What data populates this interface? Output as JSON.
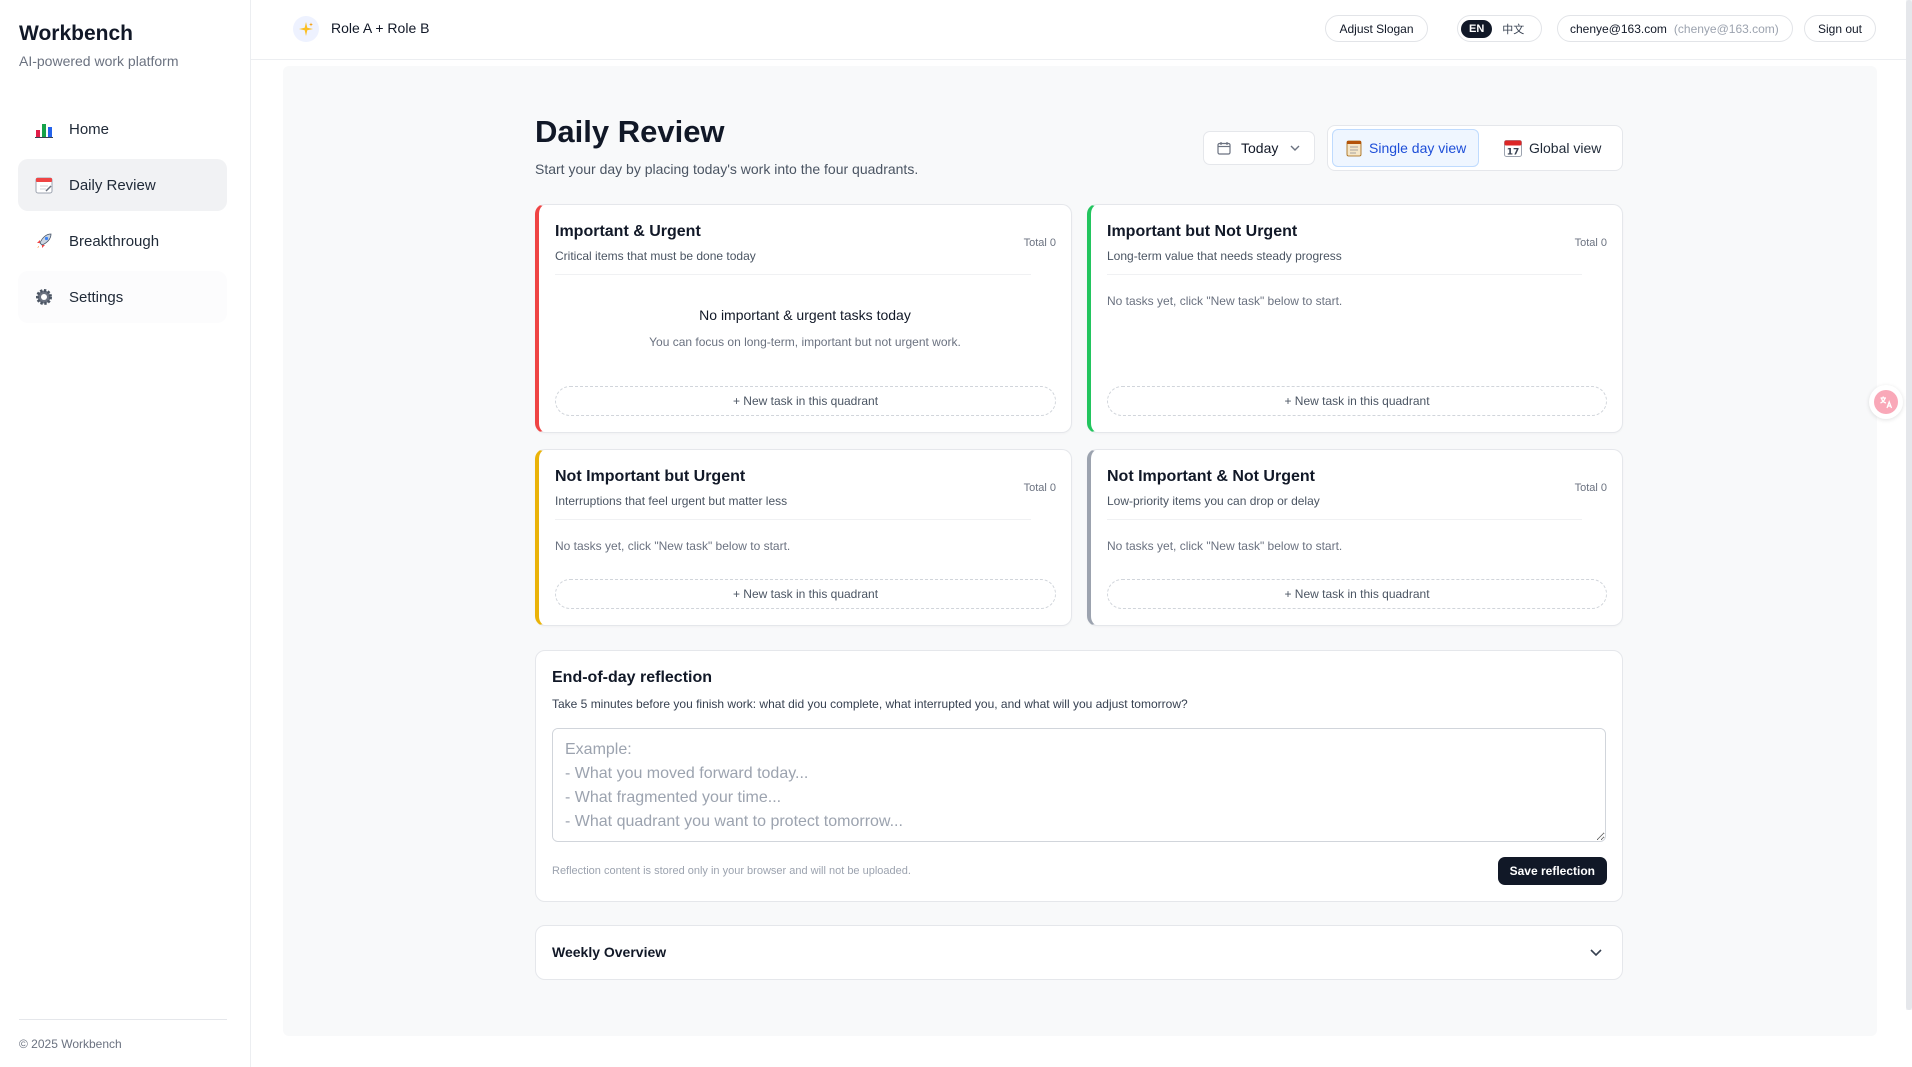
{
  "app": {
    "title": "Workbench",
    "subtitle": "AI-powered work platform",
    "footer": "© 2025 Workbench"
  },
  "nav": {
    "items": [
      {
        "label": "Home",
        "icon": "bar-chart-icon"
      },
      {
        "label": "Daily Review",
        "icon": "calendar-icon",
        "active": true
      },
      {
        "label": "Breakthrough",
        "icon": "rocket-icon"
      },
      {
        "label": "Settings",
        "icon": "gear-icon"
      }
    ]
  },
  "topbar": {
    "slogan": "Role A + Role B",
    "adjust_slogan": "Adjust Slogan",
    "lang_en": "EN",
    "lang_zh": "中文",
    "user_email": "chenye@163.com",
    "user_email_sub": "(chenye@163.com)",
    "sign_out": "Sign out"
  },
  "page": {
    "title": "Daily Review",
    "subtitle": "Start your day by placing today's work into the four quadrants.",
    "date_select": "Today",
    "view_single": "Single day view",
    "view_global": "Global view"
  },
  "quadrants": [
    {
      "title": "Important & Urgent",
      "subtitle": "Critical items that must be done today",
      "total": "Total 0",
      "empty_title": "No important & urgent tasks today",
      "empty_sub": "You can focus on long-term, important but not urgent work.",
      "add": "+ New task in this quadrant",
      "color": "#ef4444"
    },
    {
      "title": "Important but Not Urgent",
      "subtitle": "Long-term value that needs steady progress",
      "total": "Total 0",
      "empty": "No tasks yet, click \"New task\" below to start.",
      "add": "+ New task in this quadrant",
      "color": "#22c55e"
    },
    {
      "title": "Not Important but Urgent",
      "subtitle": "Interruptions that feel urgent but matter less",
      "total": "Total 0",
      "empty": "No tasks yet, click \"New task\" below to start.",
      "add": "+ New task in this quadrant",
      "color": "#eab308"
    },
    {
      "title": "Not Important & Not Urgent",
      "subtitle": "Low-priority items you can drop or delay",
      "total": "Total 0",
      "empty": "No tasks yet, click \"New task\" below to start.",
      "add": "+ New task in this quadrant",
      "color": "#9ca3af"
    }
  ],
  "reflection": {
    "title": "End-of-day reflection",
    "subtitle": "Take 5 minutes before you finish work: what did you complete, what interrupted you, and what will you adjust tomorrow?",
    "placeholder": "Example:\n- What you moved forward today...\n- What fragmented your time...\n- What quadrant you want to protect tomorrow...",
    "value": "",
    "note": "Reflection content is stored only in your browser and will not be uploaded.",
    "save": "Save reflection"
  },
  "weekly": {
    "title": "Weekly Overview"
  },
  "colors": {
    "accent": "#1d4ed8",
    "dark": "#111827"
  }
}
